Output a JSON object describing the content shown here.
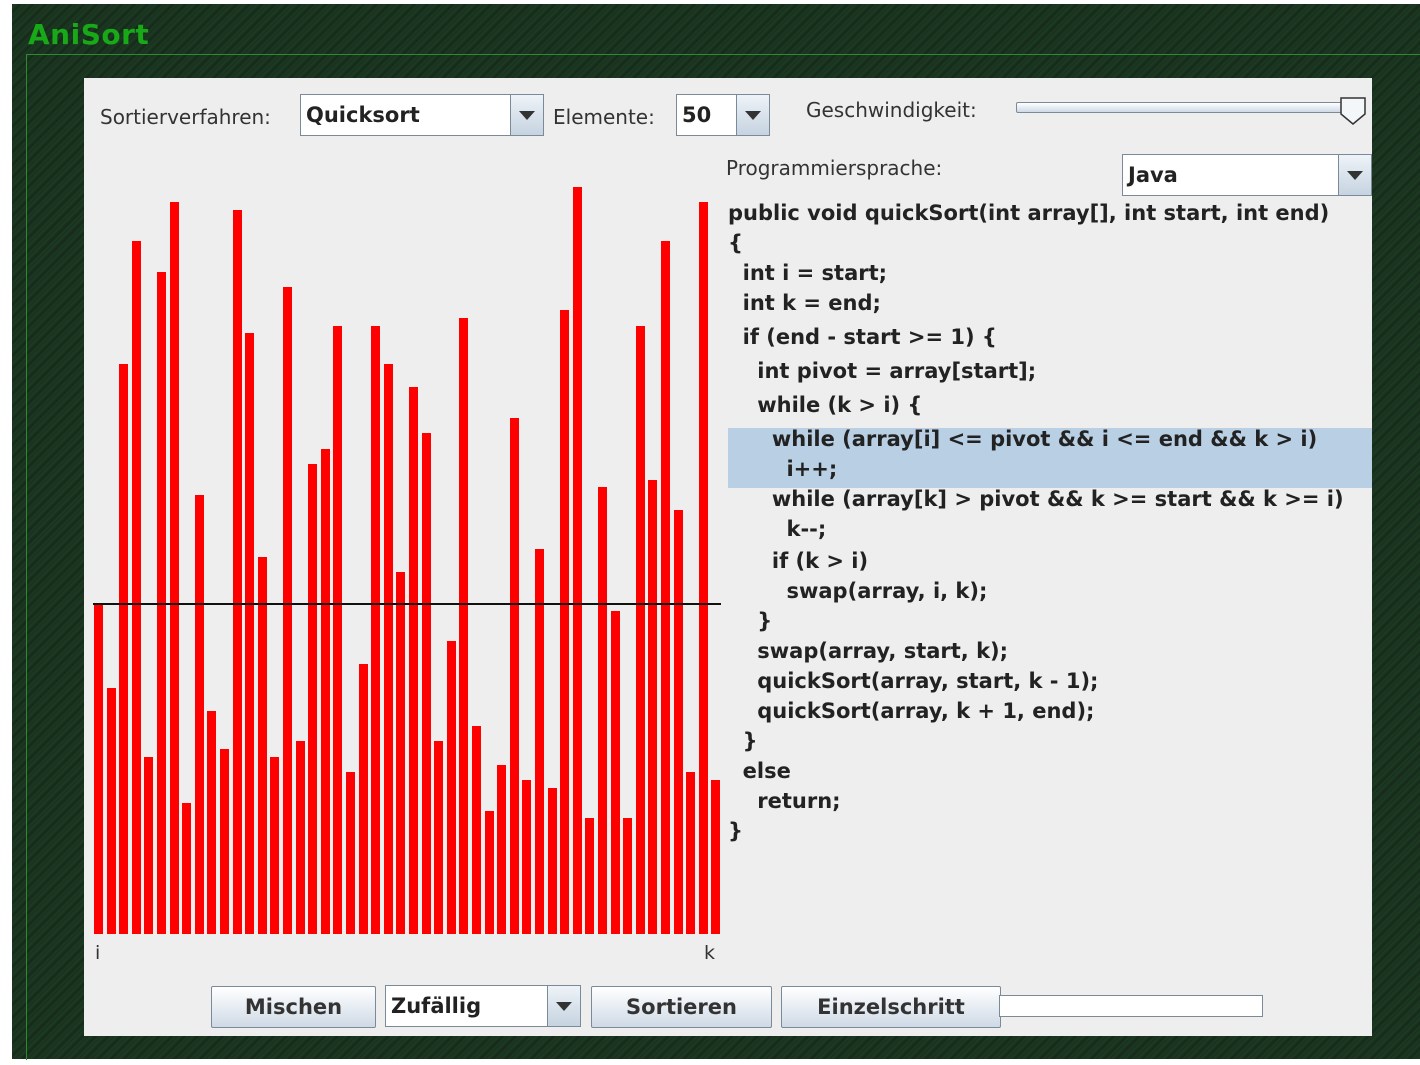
{
  "app": {
    "title": "AniSort"
  },
  "toolbar": {
    "algorithm_label": "Sortierverfahren:",
    "algorithm_value": "Quicksort",
    "elements_label": "Elemente:",
    "elements_value": "50",
    "speed_label": "Geschwindigkeit:",
    "speed_level": 1.0,
    "language_label": "Programmiersprache:",
    "language_value": "Java"
  },
  "visualization": {
    "bar_color": "#ff0000",
    "left_marker": "i",
    "right_marker": "k",
    "pivot_value": 0.43,
    "bar_values": [
      0.43,
      0.32,
      0.74,
      0.9,
      0.23,
      0.86,
      0.95,
      0.17,
      0.57,
      0.29,
      0.24,
      0.94,
      0.78,
      0.49,
      0.23,
      0.84,
      0.25,
      0.61,
      0.63,
      0.79,
      0.21,
      0.35,
      0.79,
      0.74,
      0.47,
      0.71,
      0.65,
      0.25,
      0.38,
      0.8,
      0.27,
      0.16,
      0.22,
      0.67,
      0.2,
      0.5,
      0.19,
      0.81,
      0.97,
      0.15,
      0.58,
      0.42,
      0.15,
      0.79,
      0.59,
      0.9,
      0.55,
      0.21,
      0.95,
      0.2
    ]
  },
  "code": {
    "highlight_color": "#b8cfe4",
    "lines": [
      "public void quickSort(int array[], int start, int end)",
      "{",
      "  int i = start;",
      "  int k = end;",
      "  if (end - start >= 1) {",
      "    int pivot = array[start];",
      "    while (k > i) {",
      "      while (array[i] <= pivot && i <= end && k > i)",
      "        i++;",
      "      while (array[k] > pivot && k >= start && k >= i)",
      "        k--;",
      "      if (k > i)",
      "        swap(array, i, k);",
      "    }",
      "    swap(array, start, k);",
      "    quickSort(array, start, k - 1);",
      "    quickSort(array, k + 1, end);",
      "  }",
      "  else",
      "    return;",
      "}"
    ]
  },
  "bottom": {
    "shuffle_label": "Mischen",
    "shuffle_mode": "Zufällig",
    "sort_label": "Sortieren",
    "step_label": "Einzelschritt",
    "progress": 0.0
  },
  "colors": {
    "accent_title": "#18a818",
    "frame_bg": "#1b3520",
    "panel_bg": "#eeeeee"
  }
}
